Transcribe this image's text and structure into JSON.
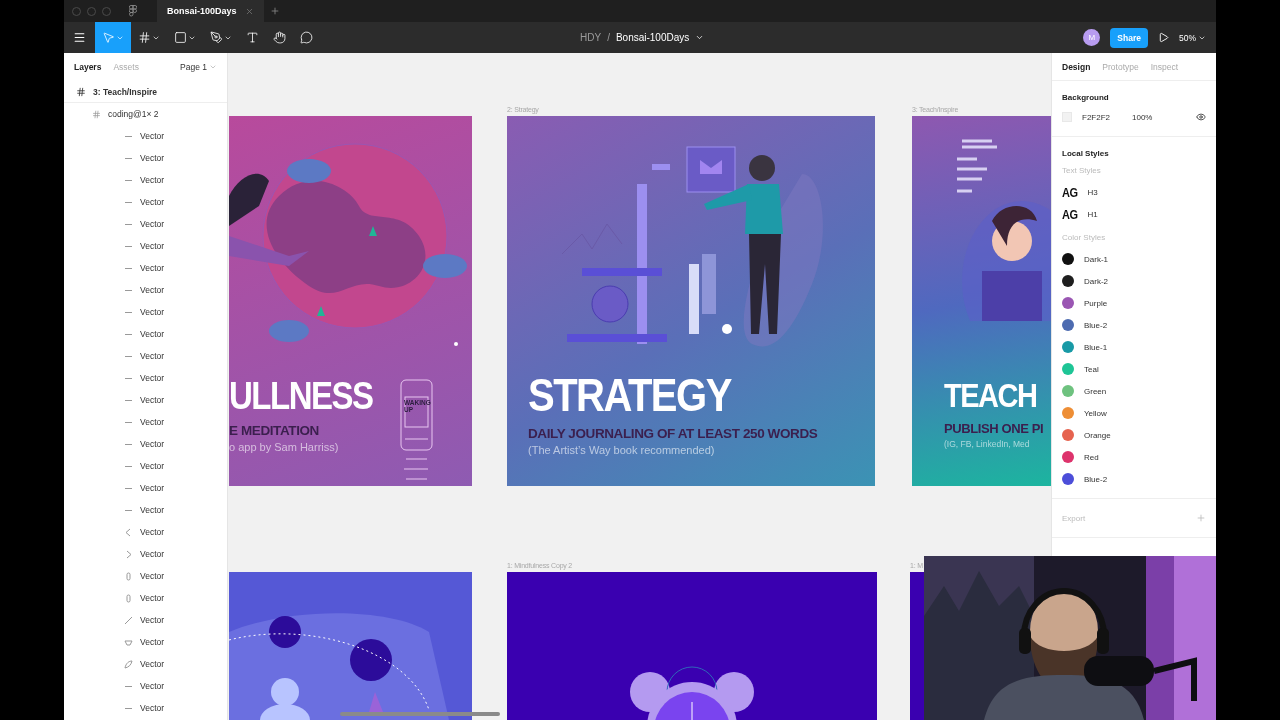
{
  "title_bar": {
    "tab": {
      "title": "Bonsai-100Days",
      "selected": true
    }
  },
  "toolbar": {
    "tools": [
      {
        "kind": "move",
        "selected": true,
        "menu": true
      },
      {
        "kind": "frame",
        "selected": false,
        "menu": true
      },
      {
        "kind": "shape",
        "selected": false,
        "menu": true
      },
      {
        "kind": "pen",
        "selected": false,
        "menu": true
      },
      {
        "kind": "text",
        "selected": false,
        "menu": false
      },
      {
        "kind": "hand",
        "selected": false,
        "menu": false
      },
      {
        "kind": "comment",
        "selected": false,
        "menu": false
      }
    ],
    "breadcrumb": {
      "team": "HDY",
      "separator": "/",
      "file": "Bonsai-100Days"
    },
    "avatar": "M",
    "share": "Share",
    "zoom": "50%"
  },
  "layers_panel": {
    "tabs": [
      {
        "label": "Layers",
        "selected": true
      },
      {
        "label": "Assets",
        "selected": false
      }
    ],
    "page": "Page 1",
    "layers": [
      {
        "name": "3: Teach/Inspire",
        "kind": "frame",
        "children": [
          {
            "name": "coding@1× 2",
            "kind": "frame",
            "children": [
              {
                "name": "Vector",
                "kind": "line"
              },
              {
                "name": "Vector",
                "kind": "line"
              },
              {
                "name": "Vector",
                "kind": "line"
              },
              {
                "name": "Vector",
                "kind": "line"
              },
              {
                "name": "Vector",
                "kind": "line"
              },
              {
                "name": "Vector",
                "kind": "line"
              },
              {
                "name": "Vector",
                "kind": "line"
              },
              {
                "name": "Vector",
                "kind": "line"
              },
              {
                "name": "Vector",
                "kind": "line"
              },
              {
                "name": "Vector",
                "kind": "line"
              },
              {
                "name": "Vector",
                "kind": "line"
              },
              {
                "name": "Vector",
                "kind": "line"
              },
              {
                "name": "Vector",
                "kind": "line"
              },
              {
                "name": "Vector",
                "kind": "line"
              },
              {
                "name": "Vector",
                "kind": "line"
              },
              {
                "name": "Vector",
                "kind": "line"
              },
              {
                "name": "Vector",
                "kind": "line"
              },
              {
                "name": "Vector",
                "kind": "line"
              },
              {
                "name": "Vector",
                "kind": "chevron-left"
              },
              {
                "name": "Vector",
                "kind": "chevron-right"
              },
              {
                "name": "Vector",
                "kind": "pill"
              },
              {
                "name": "Vector",
                "kind": "pill"
              },
              {
                "name": "Vector",
                "kind": "slash"
              },
              {
                "name": "Vector",
                "kind": "cup"
              },
              {
                "name": "Vector",
                "kind": "leaf"
              },
              {
                "name": "Vector",
                "kind": "line"
              },
              {
                "name": "Vector",
                "kind": "line"
              }
            ]
          }
        ]
      }
    ]
  },
  "canvas": {
    "rows": [
      {
        "frames": [
          {
            "kind": "mindfulness",
            "heading": "ULLNESS",
            "subheading": "E MEDITATION",
            "note": "o app by Sam Harriss)",
            "phone_label": "WAKING UP"
          },
          {
            "kind": "strategy",
            "label": "2: Strategy",
            "heading": "STRATEGY",
            "subheading": "DAILY JOURNALING OF AT LEAST 250 WORDS",
            "note": "(The Artist’s Way book recommended)"
          },
          {
            "kind": "teach",
            "label": "3: Teach/Inspire",
            "heading": "TEACH",
            "subheading": "PUBLISH ONE PI",
            "note": "(IG, FB, LinkedIn, Med"
          }
        ]
      },
      {
        "frames": [
          {
            "kind": "orbit"
          },
          {
            "kind": "clock",
            "label": "1: Mindfulness Copy 2"
          },
          {
            "kind": "plain",
            "label": "1: M"
          }
        ]
      }
    ]
  },
  "design_panel": {
    "tabs": [
      {
        "label": "Design",
        "selected": true
      },
      {
        "label": "Prototype",
        "selected": false
      },
      {
        "label": "Inspect",
        "selected": false
      }
    ],
    "background": {
      "title": "Background",
      "hex": "F2F2F2",
      "opacity": "100%",
      "visible": true
    },
    "local_styles": {
      "title": "Local Styles",
      "text_heading": "Text Styles",
      "text_styles": [
        {
          "sample": "AG",
          "name": "H3"
        },
        {
          "sample": "AG",
          "name": "H1"
        }
      ],
      "color_heading": "Color Styles",
      "color_styles": [
        {
          "name": "Dark-1",
          "color": "#111111"
        },
        {
          "name": "Dark-2",
          "color": "#1e1e1e"
        },
        {
          "name": "Purple",
          "color": "#9a56b3"
        },
        {
          "name": "Blue-2",
          "color": "#4d6bb0"
        },
        {
          "name": "Blue-1",
          "color": "#189aa6"
        },
        {
          "name": "Teal",
          "color": "#1ec596"
        },
        {
          "name": "Green",
          "color": "#6ec27f"
        },
        {
          "name": "Yellow",
          "color": "#ee8e35"
        },
        {
          "name": "Orange",
          "color": "#e6634f"
        },
        {
          "name": "Red",
          "color": "#dd336c"
        },
        {
          "name": "Blue-2",
          "color": "#4c4ed9"
        }
      ]
    },
    "export": {
      "title": "Export"
    }
  }
}
